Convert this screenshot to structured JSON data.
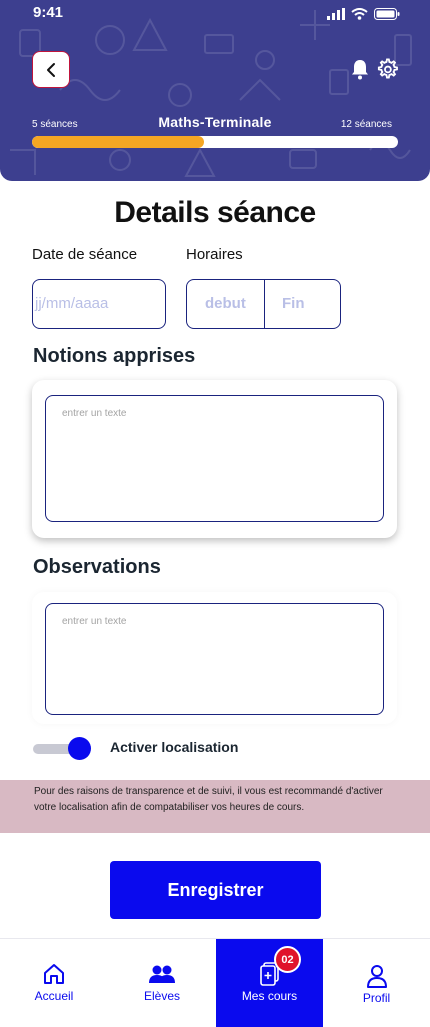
{
  "statusbar": {
    "time": "9:41"
  },
  "header": {
    "course_title": "Maths-Terminale",
    "sessions_done": "5 séances",
    "sessions_total": "12 séances",
    "progress": 0.47
  },
  "page": {
    "title": "Details séance"
  },
  "form": {
    "date_label": "Date de séance",
    "date_placeholder": "jj/mm/aaaa",
    "hours_label": "Horaires",
    "start_placeholder": "debut",
    "end_placeholder": "Fin",
    "notions_title": "Notions apprises",
    "notions_placeholder": "entrer un texte",
    "observations_title": "Observations",
    "observations_placeholder": "entrer un texte",
    "location_toggle_label": "Activer localisation",
    "location_enabled": true
  },
  "notice": {
    "text": "Pour des raisons de transparence et de suivi, il vous est recommandé d'activer votre localisation afin de compatabiliser vos heures de cours."
  },
  "actions": {
    "save_label": "Enregistrer"
  },
  "tabbar": {
    "items": [
      {
        "label": "Accueil",
        "icon": "home-icon"
      },
      {
        "label": "Elèves",
        "icon": "users-icon"
      },
      {
        "label": "Mes cours",
        "icon": "courses-icon",
        "badge": "02",
        "active": true
      },
      {
        "label": "Profil",
        "icon": "user-icon"
      }
    ]
  },
  "colors": {
    "header": "#3d3f8f",
    "accent": "#0a0aee",
    "progress": "#f5a623",
    "notice": "#d8b9c3",
    "badge": "#e0132b"
  }
}
